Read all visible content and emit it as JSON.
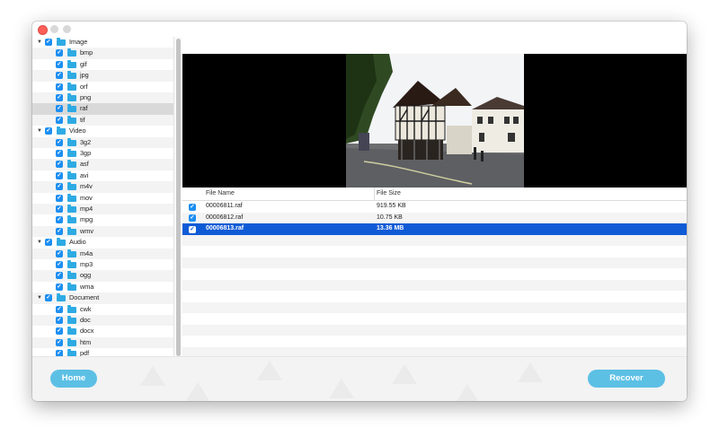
{
  "window": {
    "title": ""
  },
  "tree": {
    "rows": [
      {
        "label": "Image",
        "group": true
      },
      {
        "label": "bmp",
        "group": false
      },
      {
        "label": "gif",
        "group": false
      },
      {
        "label": "jpg",
        "group": false
      },
      {
        "label": "orf",
        "group": false
      },
      {
        "label": "png",
        "group": false
      },
      {
        "label": "raf",
        "group": false,
        "selected": true
      },
      {
        "label": "tif",
        "group": false
      },
      {
        "label": "Video",
        "group": true
      },
      {
        "label": "3g2",
        "group": false
      },
      {
        "label": "3gp",
        "group": false
      },
      {
        "label": "asf",
        "group": false
      },
      {
        "label": "avi",
        "group": false
      },
      {
        "label": "m4v",
        "group": false
      },
      {
        "label": "mov",
        "group": false
      },
      {
        "label": "mp4",
        "group": false
      },
      {
        "label": "mpg",
        "group": false
      },
      {
        "label": "wmv",
        "group": false
      },
      {
        "label": "Audio",
        "group": true
      },
      {
        "label": "m4a",
        "group": false
      },
      {
        "label": "mp3",
        "group": false
      },
      {
        "label": "ogg",
        "group": false
      },
      {
        "label": "wma",
        "group": false
      },
      {
        "label": "Document",
        "group": true
      },
      {
        "label": "cwk",
        "group": false
      },
      {
        "label": "doc",
        "group": false
      },
      {
        "label": "docx",
        "group": false
      },
      {
        "label": "htm",
        "group": false
      },
      {
        "label": "pdf",
        "group": false
      }
    ]
  },
  "file_list": {
    "col_name": "File Name",
    "col_size": "File Size",
    "files": [
      {
        "name": "00006811.raf",
        "size": "919.55 KB",
        "checked": true,
        "selected": false
      },
      {
        "name": "00006812.raf",
        "size": "10.75 KB",
        "checked": true,
        "selected": false
      },
      {
        "name": "00006813.raf",
        "size": "13.36 MB",
        "checked": true,
        "selected": true
      }
    ]
  },
  "buttons": {
    "home": "Home",
    "recover": "Recover"
  },
  "colors": {
    "accent_button": "#5cc0e5",
    "selection": "#0f5bd6",
    "checkbox": "#1d8ff2",
    "folder": "#2eaae3"
  },
  "icons": {
    "check": "✓",
    "disclosure": "▼"
  }
}
